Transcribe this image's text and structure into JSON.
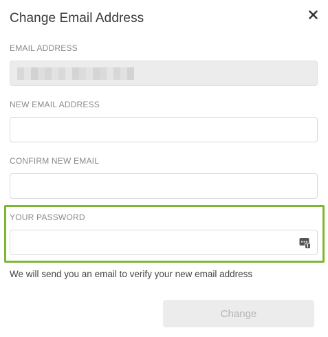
{
  "dialog": {
    "title": "Change Email Address",
    "close_icon": "close-icon"
  },
  "fields": {
    "current_email": {
      "label": "EMAIL ADDRESS",
      "value": ""
    },
    "new_email": {
      "label": "NEW EMAIL ADDRESS",
      "value": "",
      "placeholder": ""
    },
    "confirm_email": {
      "label": "CONFIRM NEW EMAIL",
      "value": "",
      "placeholder": ""
    },
    "password": {
      "label": "YOUR PASSWORD",
      "value": "",
      "placeholder": "",
      "icon": "password-manager-icon"
    }
  },
  "note": "We will send you an email to verify your new email address",
  "buttons": {
    "change": "Change"
  },
  "colors": {
    "highlight": "#7cb82f",
    "disabled_button_bg": "#ececec",
    "disabled_button_text": "#b5b5b5",
    "readonly_field_bg": "#ececec"
  }
}
